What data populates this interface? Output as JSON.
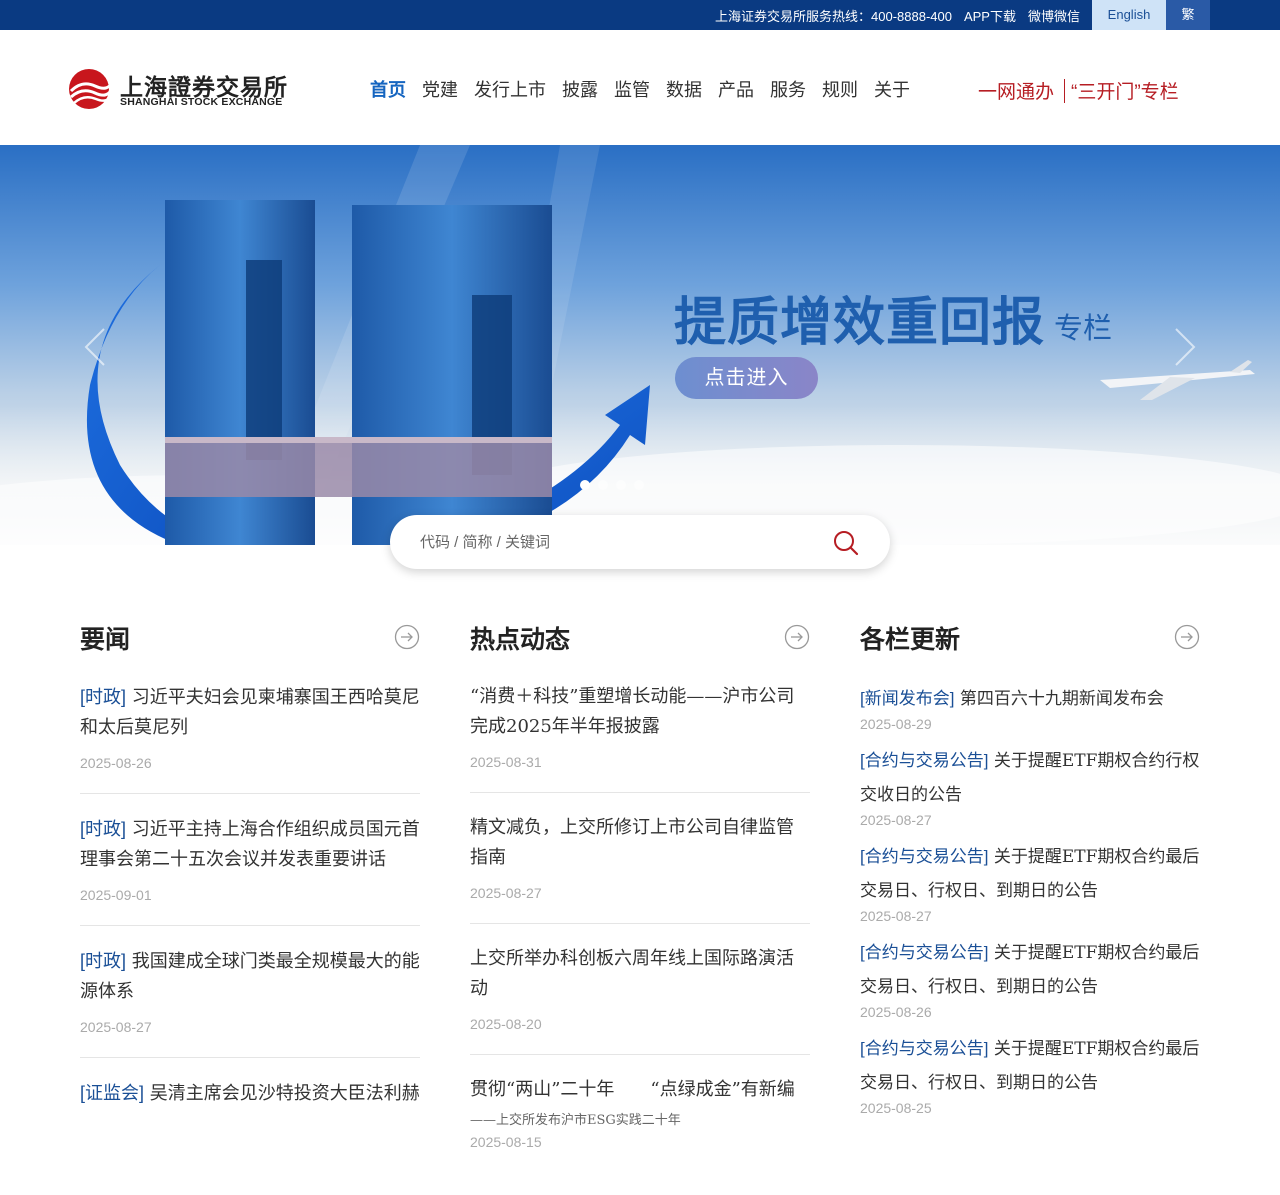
{
  "topbar": {
    "hotline": "上海证券交易所服务热线：400-8888-400",
    "app_download": "APP下载",
    "weibo_weixin": "微博微信",
    "english": "English",
    "traditional": "繁"
  },
  "logo": {
    "cn": "上海證券交易所",
    "en": "SHANGHAI STOCK EXCHANGE"
  },
  "nav": {
    "items": [
      "首页",
      "党建",
      "发行上市",
      "披露",
      "监管",
      "数据",
      "产品",
      "服务",
      "规则",
      "关于"
    ],
    "active_index": 0
  },
  "special_links": [
    "一网通办",
    "“三开门”专栏"
  ],
  "banner": {
    "headline": "提质增效重回报",
    "headline_sub": "专栏",
    "button": "点击进入",
    "dot_count": 4,
    "active_dot": 0
  },
  "search": {
    "placeholder": "代码 / 简称 / 关键词"
  },
  "columns": {
    "news": {
      "title": "要闻",
      "items": [
        {
          "tag": "[时政]",
          "title": "习近平夫妇会见柬埔寨国王西哈莫尼和太后莫尼列",
          "date": "2025-08-26"
        },
        {
          "tag": "[时政]",
          "title": "习近平主持上海合作组织成员国元首理事会第二十五次会议并发表重要讲话",
          "date": "2025-09-01"
        },
        {
          "tag": "[时政]",
          "title": "我国建成全球门类最全规模最大的能源体系",
          "date": "2025-08-27"
        },
        {
          "tag": "[证监会]",
          "title": "吴清主席会见沙特投资大臣法利赫",
          "date": ""
        }
      ]
    },
    "hot": {
      "title": "热点动态",
      "items": [
        {
          "title": "“消费＋科技”重塑增长动能——沪市公司完成2025年半年报披露",
          "subtitle": "",
          "date": "2025-08-31"
        },
        {
          "title": "精文减负，上交所修订上市公司自律监管指南",
          "subtitle": "",
          "date": "2025-08-27"
        },
        {
          "title": "上交所举办科创板六周年线上国际路演活动",
          "subtitle": "",
          "date": "2025-08-20"
        },
        {
          "title": "贯彻“两山”二十年　　“点绿成金”有新编",
          "subtitle": "——上交所发布沪市ESG实践二十年",
          "date": "2025-08-15"
        }
      ]
    },
    "updates": {
      "title": "各栏更新",
      "items": [
        {
          "tag": "[新闻发布会]",
          "title": "第四百六十九期新闻发布会",
          "date": "2025-08-29"
        },
        {
          "tag": "[合约与交易公告]",
          "title": "关于提醒ETF期权合约行权交收日的公告",
          "date": "2025-08-27"
        },
        {
          "tag": "[合约与交易公告]",
          "title": "关于提醒ETF期权合约最后交易日、行权日、到期日的公告",
          "date": "2025-08-27"
        },
        {
          "tag": "[合约与交易公告]",
          "title": "关于提醒ETF期权合约最后交易日、行权日、到期日的公告",
          "date": "2025-08-26"
        },
        {
          "tag": "[合约与交易公告]",
          "title": "关于提醒ETF期权合约最后交易日、行权日、到期日的公告",
          "date": "2025-08-25"
        }
      ]
    }
  },
  "colors": {
    "topbar": "#0a3a82",
    "nav_active": "#1565c0",
    "accent_red": "#b61d23",
    "tag_blue": "#1a4f96"
  }
}
